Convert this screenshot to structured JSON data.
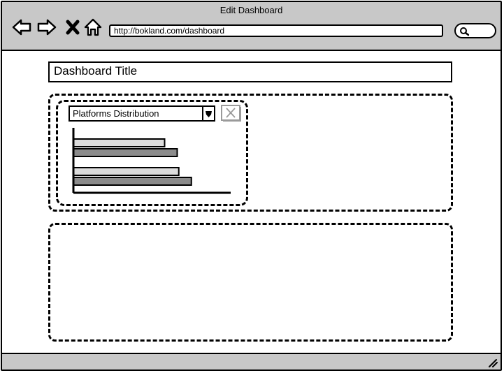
{
  "window": {
    "title": "Edit Dashboard"
  },
  "browser": {
    "url": "http://bokland.com/dashboard",
    "icons": [
      "back-arrow-icon",
      "forward-arrow-icon",
      "close-x-icon",
      "home-icon",
      "search-icon"
    ]
  },
  "dashboard": {
    "title": "Dashboard Title"
  },
  "widget": {
    "select_value": "Platforms Distribution",
    "icons": [
      "dropdown-arrow-icon",
      "close-icon"
    ]
  },
  "chart_data": {
    "type": "bar",
    "orientation": "horizontal",
    "categories": [
      "",
      ""
    ],
    "series": [
      {
        "values": [
          58,
          67
        ],
        "color": "#dcdcdc"
      },
      {
        "values": [
          66,
          75
        ],
        "color": "#8c8c8c"
      }
    ],
    "xlim": [
      0,
      100
    ],
    "colors": {
      "light": "#dcdcdc",
      "dark": "#8c8c8c"
    }
  },
  "colors": {
    "chrome": "#c8c8c8",
    "page": "#ffffff",
    "stroke": "#000000"
  }
}
